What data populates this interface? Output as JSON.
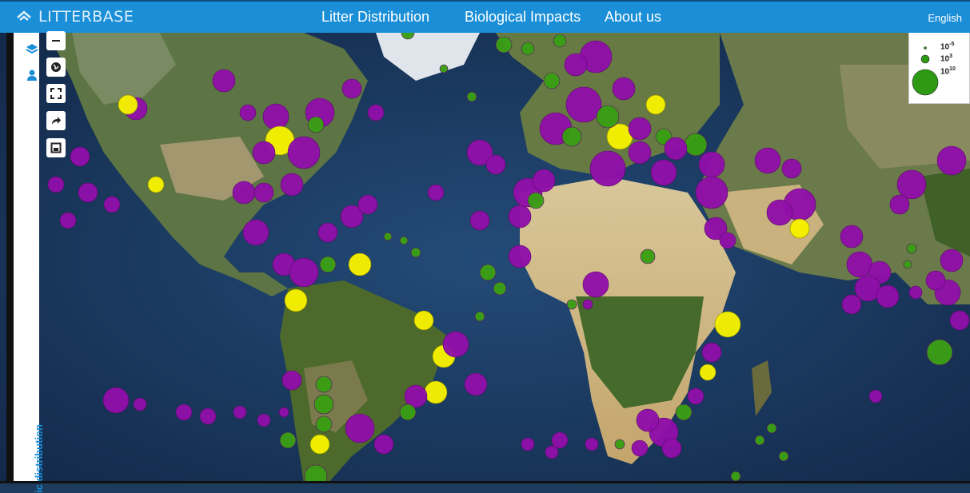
{
  "header": {
    "logo_text": "LITTERBASE",
    "nav": [
      {
        "label": "Litter Distribution"
      },
      {
        "label": "Biological Impacts"
      },
      {
        "label": "About us"
      }
    ],
    "language": "English"
  },
  "sidebar": {
    "vertical_label": "ic distribution",
    "icons": [
      "layers-icon",
      "user-icon"
    ]
  },
  "map_controls": [
    "zoom-out-button",
    "globe-button",
    "fullscreen-button",
    "share-button",
    "print-button"
  ],
  "legend": {
    "entries": [
      {
        "base": "10",
        "exponent": "-5"
      },
      {
        "base": "10",
        "exponent": "3"
      },
      {
        "base": "10",
        "exponent": "10"
      }
    ],
    "marker_color": "#2e9a14"
  },
  "colors": {
    "header_bg": "#1a8fd8",
    "purple": "#8f0fa8",
    "green": "#3a9e14",
    "yellow": "#f5f000"
  }
}
